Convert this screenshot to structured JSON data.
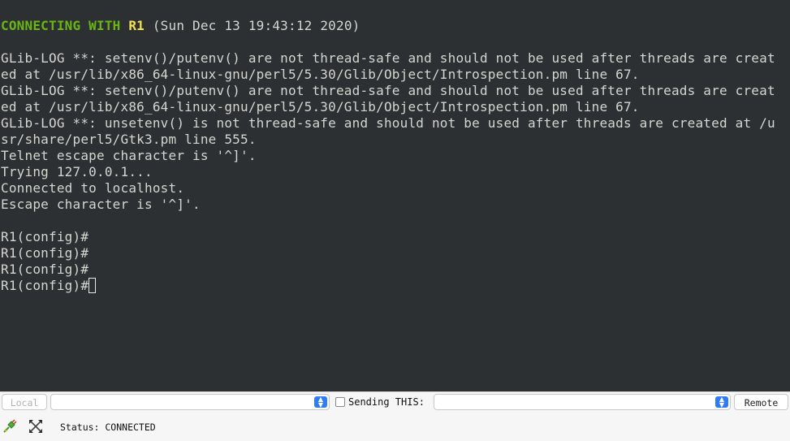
{
  "terminal": {
    "header": {
      "prefix": "CONNECTING WITH ",
      "router": "R1",
      "timestamp": " (Sun Dec 13 19:43:12 2020)"
    },
    "lines": [
      "GLib-LOG **: setenv()/putenv() are not thread-safe and should not be used after threads are creat",
      "ed at /usr/lib/x86_64-linux-gnu/perl5/5.30/Glib/Object/Introspection.pm line 67.",
      "GLib-LOG **: setenv()/putenv() are not thread-safe and should not be used after threads are creat",
      "ed at /usr/lib/x86_64-linux-gnu/perl5/5.30/Glib/Object/Introspection.pm line 67.",
      "GLib-LOG **: unsetenv() is not thread-safe and should not be used after threads are created at /u",
      "sr/share/perl5/Gtk3.pm line 555.",
      "Telnet escape character is '^]'.",
      "Trying 127.0.0.1...",
      "Connected to localhost.",
      "Escape character is '^]'.",
      "",
      "R1(config)#",
      "R1(config)#",
      "R1(config)#"
    ],
    "prompt": "R1(config)#",
    "colors": {
      "background": "#2c3033",
      "text": "#d3d7cf",
      "header_green": "#6ab516",
      "header_yellow": "#f2e054"
    }
  },
  "bottom": {
    "local_button": "Local",
    "local_combo_value": "",
    "sending_label": "Sending THIS:",
    "sending_combo_value": "",
    "remote_button": "Remote",
    "status_text": "Status: CONNECTED",
    "icons": [
      "connect-plug-icon",
      "expand-arrows-icon"
    ]
  }
}
